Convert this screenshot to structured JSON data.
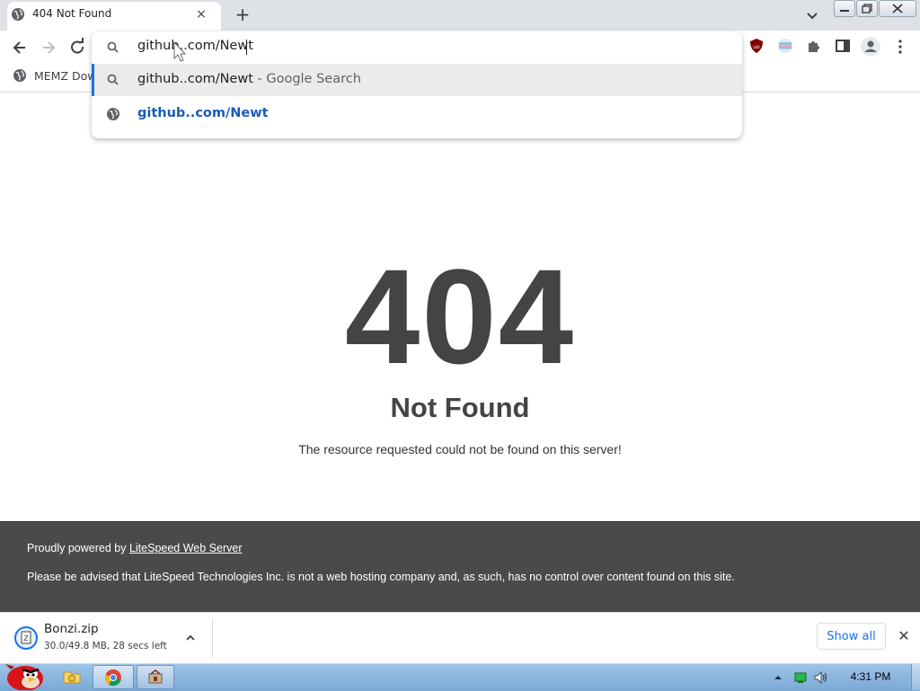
{
  "tab": {
    "title": "404 Not Found",
    "close": "×",
    "new_tab": "+"
  },
  "omnibox": {
    "value": "github..com/Newt"
  },
  "bookmarks": [
    {
      "label": "MEMZ Dow"
    }
  ],
  "suggestions": [
    {
      "text": "github..com/Newt",
      "suffix": " - Google Search",
      "icon": "search-icon"
    },
    {
      "text": "github..com/Newt",
      "icon": "globe-icon"
    }
  ],
  "page": {
    "code": "404",
    "heading": "Not Found",
    "message": "The resource requested could not be found on this server!",
    "footer_prefix": "Proudly powered by ",
    "footer_link": "LiteSpeed Web Server",
    "footer_notice": "Please be advised that LiteSpeed Technologies Inc. is not a web hosting company and, as such, has no control over content found on this site."
  },
  "download": {
    "filename": "Bonzi.zip",
    "status": "30.0/49.8 MB, 28 secs left",
    "show_all": "Show all",
    "close": "✕"
  },
  "taskbar": {
    "clock": "4:31 PM"
  },
  "colors": {
    "accent": "#1a73e8",
    "footer_bg": "#4a4a4a",
    "heading": "#444444"
  }
}
